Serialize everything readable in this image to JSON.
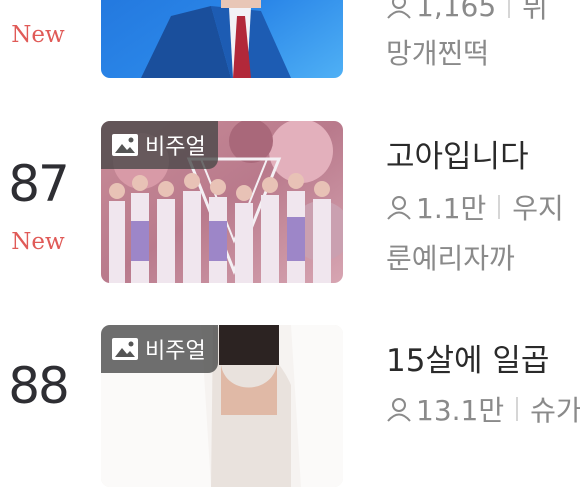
{
  "items": [
    {
      "rank": "",
      "new_label": "New",
      "badge": "",
      "title": "",
      "views": "1,165",
      "author": "뷔",
      "tags": "망개찐떡"
    },
    {
      "rank": "87",
      "new_label": "New",
      "badge": "비주얼",
      "title": "고아입니다",
      "views": "1.1만",
      "author": "우지",
      "tags": "룬예리자까"
    },
    {
      "rank": "88",
      "new_label": "",
      "badge": "비주얼",
      "title": "15살에 일곱",
      "views": "13.1만",
      "author": "슈가",
      "tags": ""
    }
  ]
}
